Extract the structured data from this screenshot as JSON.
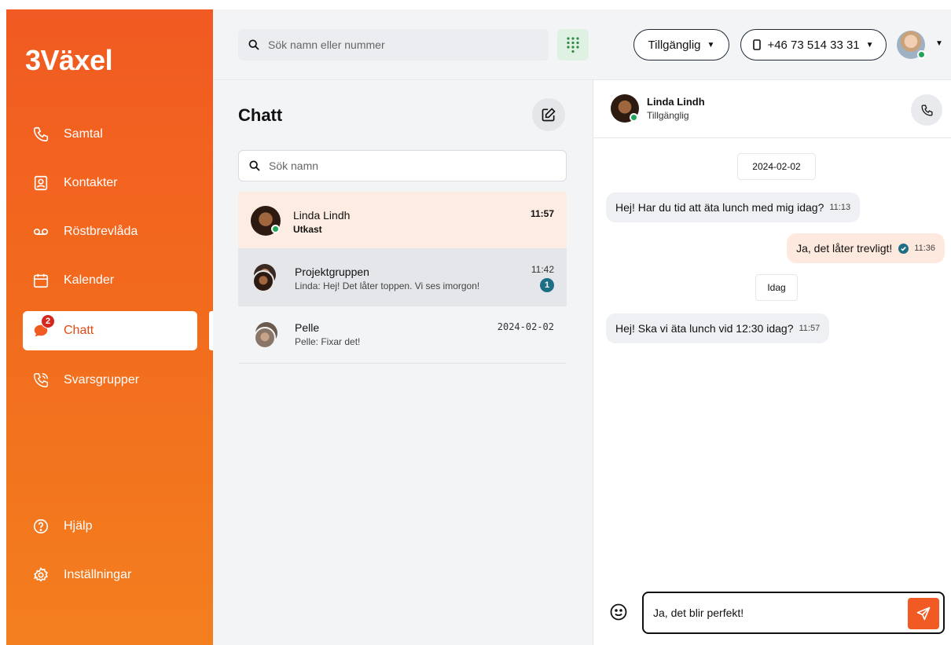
{
  "sidebar": {
    "logo": "3Växel",
    "items": [
      {
        "label": "Samtal",
        "icon": "phone-icon"
      },
      {
        "label": "Kontakter",
        "icon": "contact-card-icon"
      },
      {
        "label": "Röstbrevlåda",
        "icon": "voicemail-icon"
      },
      {
        "label": "Kalender",
        "icon": "calendar-icon"
      },
      {
        "label": "Chatt",
        "icon": "chat-bubble-icon",
        "badge": "2",
        "active": true
      },
      {
        "label": "Svarsgrupper",
        "icon": "group-phone-icon"
      }
    ],
    "bottom": [
      {
        "label": "Hjälp",
        "icon": "help-icon"
      },
      {
        "label": "Inställningar",
        "icon": "gear-icon"
      }
    ]
  },
  "topbar": {
    "search_placeholder": "Sök namn eller nummer",
    "status_label": "Tillgänglig",
    "phone_label": "+46 73 514 33 31"
  },
  "list": {
    "title": "Chatt",
    "search_placeholder": "Sök namn",
    "conversations": [
      {
        "name": "Linda Lindh",
        "preview": "Utkast",
        "time": "11:57"
      },
      {
        "name": "Projektgruppen",
        "preview": "Linda: Hej! Det låter toppen. Vi ses imorgon!",
        "time": "11:42",
        "unread": "1"
      },
      {
        "name": "Pelle",
        "preview": "Pelle: Fixar det!",
        "time": "2024-02-02"
      }
    ]
  },
  "conversation": {
    "contact_name": "Linda Lindh",
    "contact_status": "Tillgänglig",
    "date1": "2024-02-02",
    "msg1": {
      "text": "Hej! Har du tid att äta lunch med mig idag?",
      "time": "11:13"
    },
    "msg2": {
      "text": "Ja, det låter trevligt!",
      "time": "11:36"
    },
    "date2": "Idag",
    "msg3": {
      "text": "Hej! Ska vi äta lunch vid 12:30 idag?",
      "time": "11:57"
    },
    "composer_value": "Ja, det blir perfekt!"
  },
  "colors": {
    "brand_orange": "#f15a22",
    "online_green": "#22a55b",
    "badge_red": "#d4261d",
    "teal": "#1e6f86"
  }
}
